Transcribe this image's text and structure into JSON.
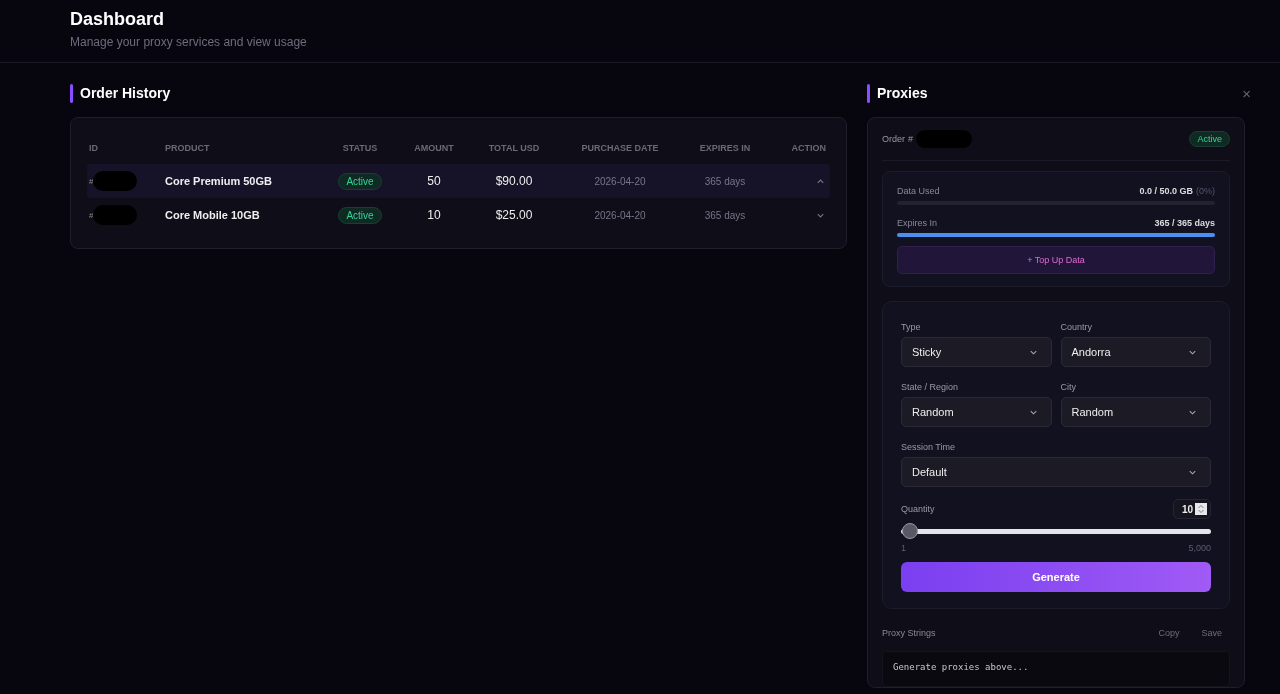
{
  "header": {
    "title": "Dashboard",
    "subtitle": "Manage your proxy services and view usage"
  },
  "orders": {
    "title": "Order History",
    "columns": [
      "ID",
      "PRODUCT",
      "STATUS",
      "AMOUNT",
      "TOTAL USD",
      "PURCHASE DATE",
      "EXPIRES IN",
      "ACTION"
    ],
    "rows": [
      {
        "id": "#",
        "product": "Core Premium 50GB",
        "status": "Active",
        "amount": "50",
        "total": "$90.00",
        "purchase_date": "2026-04-20",
        "expires_in": "365 days",
        "expanded": true
      },
      {
        "id": "#",
        "product": "Core Mobile 10GB",
        "status": "Active",
        "amount": "10",
        "total": "$25.00",
        "purchase_date": "2026-04-20",
        "expires_in": "365 days",
        "expanded": false
      }
    ]
  },
  "proxies": {
    "title": "Proxies",
    "close": "×",
    "order_label": "Order",
    "order_id": "#",
    "status": "Active",
    "usage": [
      {
        "label": "Data Used",
        "value": "0.0 / 50.0 GB",
        "note": "(0%)",
        "level": 0
      },
      {
        "label": "Expires In",
        "value": "365 / 365 days",
        "level": 1
      }
    ],
    "top_up": "+ Top Up Data",
    "fields": [
      {
        "label": "Type",
        "value": "Sticky"
      },
      {
        "label": "Country",
        "value": "Andorra"
      },
      {
        "label": "State / Region",
        "value": "Random"
      },
      {
        "label": "City",
        "value": "Random"
      },
      {
        "label": "Session Time",
        "value": "Default"
      }
    ],
    "quantity": {
      "label": "Quantity",
      "value": "10",
      "level": 0.002,
      "min": "1",
      "max": "5,000"
    },
    "generate": "Generate",
    "output": {
      "label": "Proxy Strings",
      "buttons": [
        "Copy",
        "Save"
      ],
      "placeholder": "Generate proxies above..."
    }
  }
}
